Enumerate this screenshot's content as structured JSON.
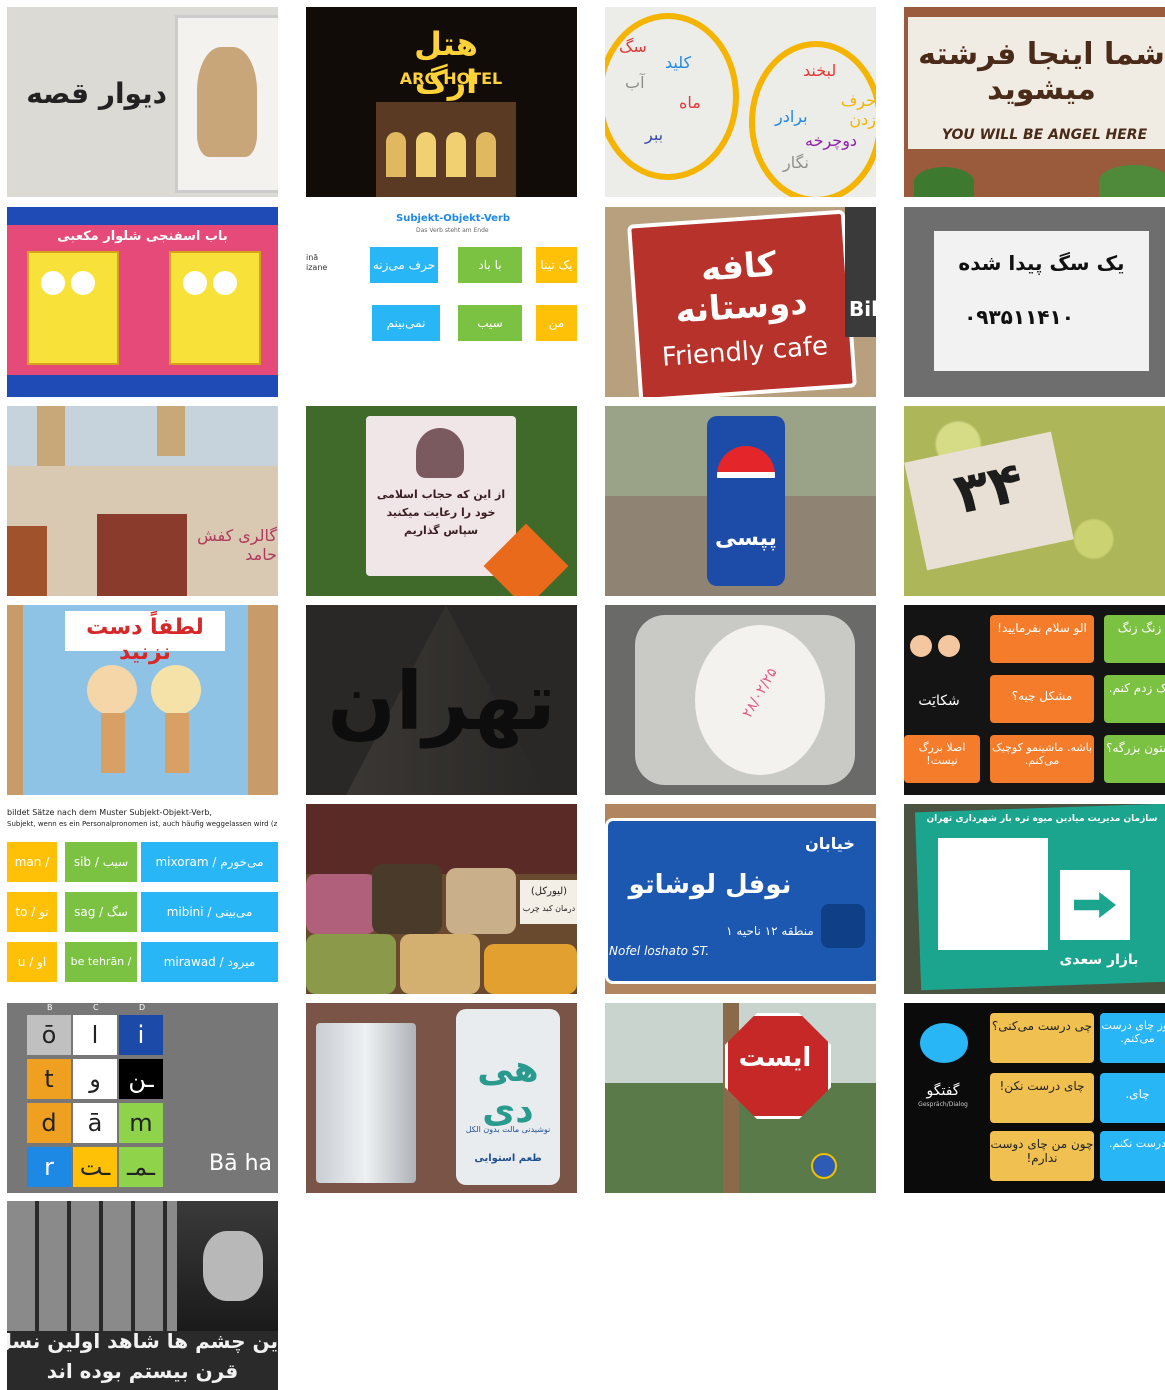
{
  "tiles": {
    "t1": {
      "text": "دیوار قصه"
    },
    "t2": {
      "fa": "هتل ارگ",
      "en": "ARG HOTEL"
    },
    "t3": {
      "left_words": [
        "سگ",
        "کلید",
        "آب",
        "ماه",
        "ببر"
      ],
      "right_words": [
        "لبخند",
        "حرف زدن",
        "برادر",
        "دوچرخه",
        "نگار"
      ]
    },
    "t4": {
      "fa": "شما اینجا فرشته میشوید",
      "en": "YOU WILL BE ANGEL HERE"
    },
    "t5": {
      "text": "باب اسفنجی شلوار مکعبی"
    },
    "t6": {
      "title": "Subjekt-Objekt-Verb",
      "subtitle": "Das Verb steht am Ende",
      "side1": "inā",
      "side2": "izane",
      "boxes": [
        "حرف می‌زنه",
        "با باد",
        "یک تینا",
        "نمی‌بینم",
        "سیب",
        "من"
      ]
    },
    "t7": {
      "fa": "کافه دوستانه",
      "en": "Friendly cafe",
      "side": "Bik"
    },
    "t8": {
      "line1": "یک سگ پیدا شده",
      "line2": "۰۹۳۵۱۱۴۱۰"
    },
    "t9": {
      "sign": "گالری کفش حامد"
    },
    "t10": {
      "line1": "از این که حجاب اسلامی",
      "line2": "خود را رعایت میکنید",
      "line3": "سپاس گذاریم"
    },
    "t11": {
      "text": "پپسی"
    },
    "t12": {
      "text": "۳۴"
    },
    "t13": {
      "text": "لطفاً دست نزنید"
    },
    "t14": {
      "text": "تهران"
    },
    "t15": {
      "text": "۲۸/۰۲/۲۵"
    },
    "t16": {
      "cells": [
        "الو سلام بفرمایید!",
        "زنگ زنگ",
        "مشکل چیه؟",
        "یک زدم کنم.",
        "باشه. ماشینمو کوچیک می‌کنم.",
        "اصلا بزرگ نیست!",
        "ستون بزرگه؟"
      ],
      "label": "شکایَت"
    },
    "t17": {
      "header": "bildet Sätze nach dem Muster Subjekt-Objekt-Verb,",
      "header2": "Subjekt, wenn es ein Personalpronomen ist, auch häufig weggelassen wird (z.B.",
      "rows": [
        [
          "man / من",
          "sib / سیب",
          "mixoram / می‌خورم"
        ],
        [
          "to / تو",
          "sag / سگ",
          "mibini / می‌بینی"
        ],
        [
          "u / او",
          "be tehrān / به تهران",
          "mirawad / میرود"
        ]
      ]
    },
    "t18": {
      "label": "(لیورکل)",
      "sub": "درمان کبد چرب"
    },
    "t19": {
      "top": "خیابان",
      "main": "نوفل لوشاتو",
      "sub": "منطقه ۱۲ ناحیه ۱",
      "en": "Nofel loshato ST."
    },
    "t20": {
      "top": "سازمان مدیریت میادین میوه تره بار شهرداری تهران",
      "bottom": "بازار سعدی"
    },
    "t21": {
      "header": [
        "B",
        "C",
        "D"
      ],
      "cells": [
        "ō",
        "ا",
        "i",
        "t",
        "و",
        "ـن",
        "d",
        "ā",
        "m",
        "r",
        "ـت",
        "ـمـ"
      ],
      "caption": "Bā ha"
    },
    "t22": {
      "brand": "هی دی",
      "line": "نوشیدنی مالت بدون الکل",
      "flavor": "طعم استوایی"
    },
    "t23": {
      "text": "ایست"
    },
    "t24": {
      "cells": [
        "چی درست می‌کنی؟",
        "روز چای درست می‌کنم.",
        "چای درست نکن!",
        "چای.",
        "چون من چای دوست ندارم!",
        "درست نکنم."
      ],
      "label": "گفتگو",
      "sub": "Gespräch/Dialog"
    },
    "t25": {
      "line1": "ین چشم ها شاهد اولین نسل کشی",
      "line2": "قرن بیستم بوده اند"
    }
  }
}
